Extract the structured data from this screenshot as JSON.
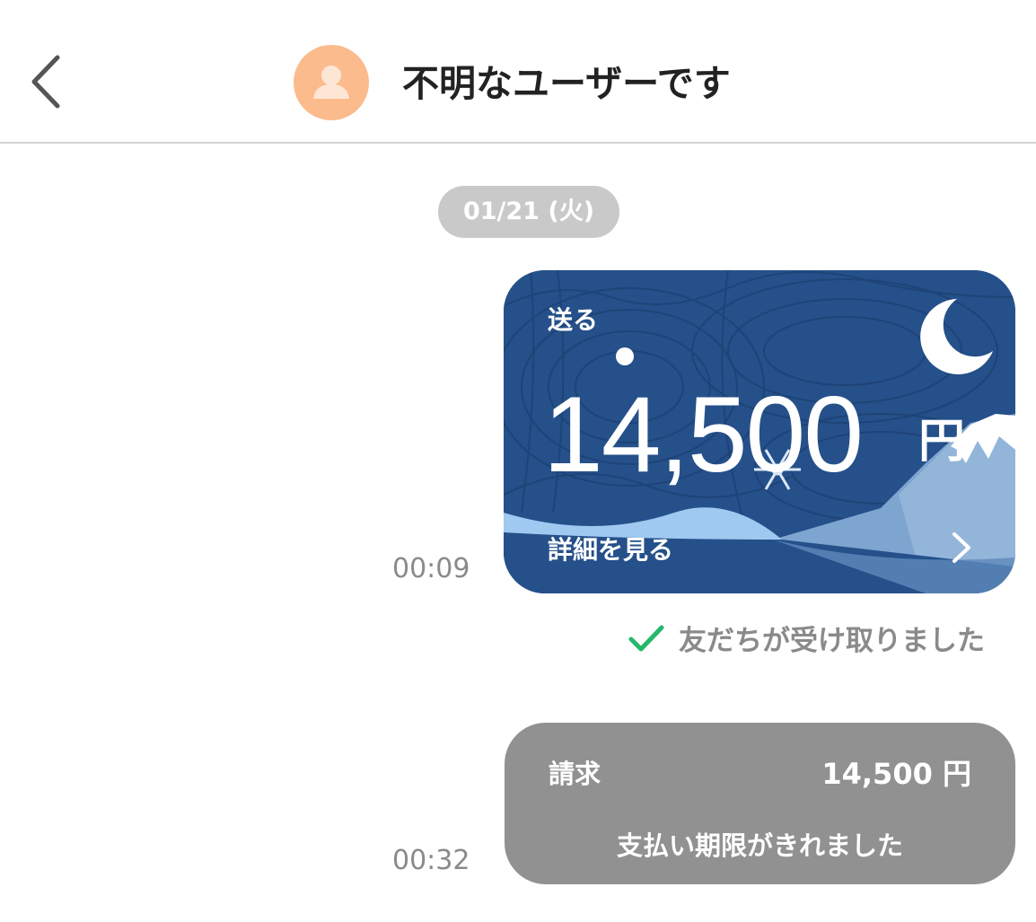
{
  "header": {
    "back_icon": "chevron-left-icon",
    "avatar_icon": "user-silhouette-icon",
    "title": "不明なユーザーです"
  },
  "date_separator": "01/21 (火)",
  "messages": [
    {
      "type": "gift_card",
      "time": "00:09",
      "label": "送る",
      "amount": "14,500",
      "currency": "円",
      "detail_link": "詳細を見る",
      "colors": {
        "card_bg": "#25508a",
        "wave": "#9fc9f0",
        "mountain": "#7da5cf"
      },
      "status": "友だちが受け取りました",
      "status_color": "#24b86a"
    },
    {
      "type": "payment_request",
      "time": "00:32",
      "label": "請求",
      "amount": "14,500 円",
      "status": "支払い期限がきれました",
      "bubble_color": "#919191"
    }
  ]
}
